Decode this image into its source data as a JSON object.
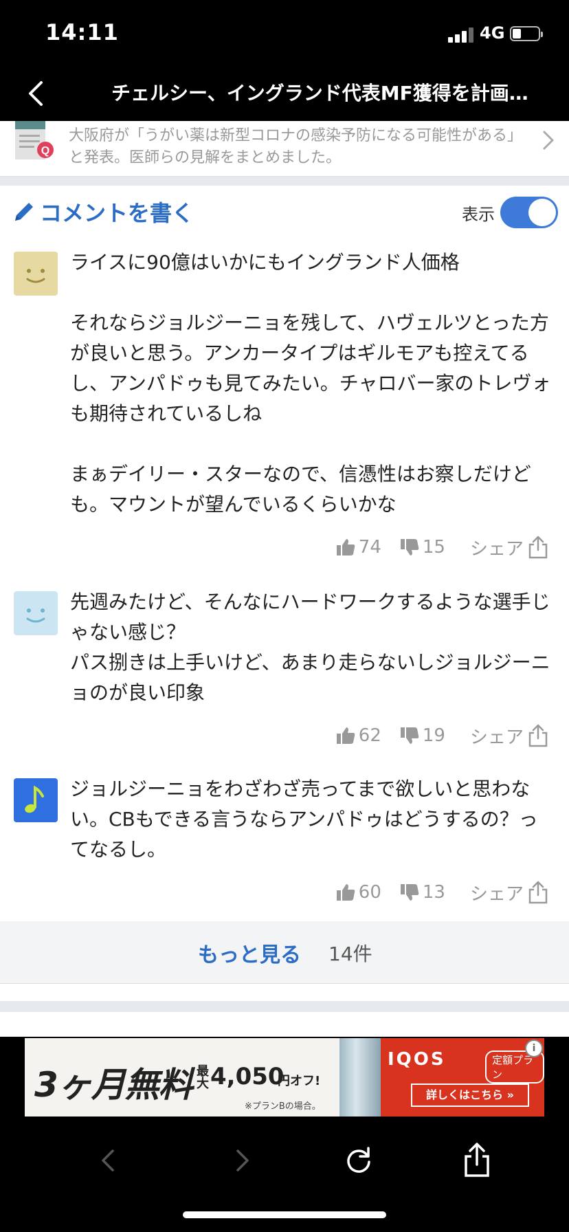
{
  "status_bar": {
    "time": "14:11",
    "network": "4G"
  },
  "nav": {
    "title": "チェルシー、イングランド代表MF獲得を計画。…"
  },
  "related_article": {
    "text": "大阪府が「うがい薬は新型コロナの感染予防になる可能性がある」と発表。医師らの見解をまとめました。",
    "thumb_icon": "article-q-icon"
  },
  "comment_header": {
    "write_label": "コメントを書く",
    "toggle_label": "表示",
    "toggle_on": true
  },
  "comments": [
    {
      "avatar": "smiley-icon",
      "avatar_color": "#e6d9a2",
      "text": "ライスに90億はいかにもイングランド人価格\n\nそれならジョルジーニョを残して、ハヴェルツとった方が良いと思う。アンカータイプはギルモアも控えてるし、アンパドゥも見てみたい。チャロバー家のトレヴォも期待されているしね\n\nまぁデイリー・スターなので、信憑性はお察しだけども。マウントが望んでいるくらいかな",
      "likes": "74",
      "dislikes": "15",
      "share": "シェア"
    },
    {
      "avatar": "smiley-icon",
      "avatar_color": "#cbe6f2",
      "text": "先週みたけど、そんなにハードワークするような選手じゃない感じ？\nパス捌きは上手いけど、あまり走らないしジョルジーニョのが良い印象",
      "likes": "62",
      "dislikes": "19",
      "share": "シェア"
    },
    {
      "avatar": "music-note-icon",
      "avatar_color": "#2f6fe0",
      "text": "ジョルジーニョをわざわざ売ってまで欲しいと思わない。CBもできる言うならアンパドゥはどうするの？ってなるし。",
      "likes": "60",
      "dislikes": "13",
      "share": "シェア"
    }
  ],
  "more": {
    "label": "もっと見る",
    "count": "14件"
  },
  "ad": {
    "headline": "3ヶ月無料",
    "max": "最大",
    "price": "4,050",
    "price_suffix": "円オフ!",
    "note": "※プランBの場合。",
    "brand": "IQOS",
    "plan": "定額プラン",
    "cta": "詳しくはこちら »",
    "info": "i"
  },
  "toolbar": {
    "icons": [
      "back-arrow-icon",
      "forward-arrow-icon",
      "reload-icon",
      "share-icon"
    ]
  }
}
